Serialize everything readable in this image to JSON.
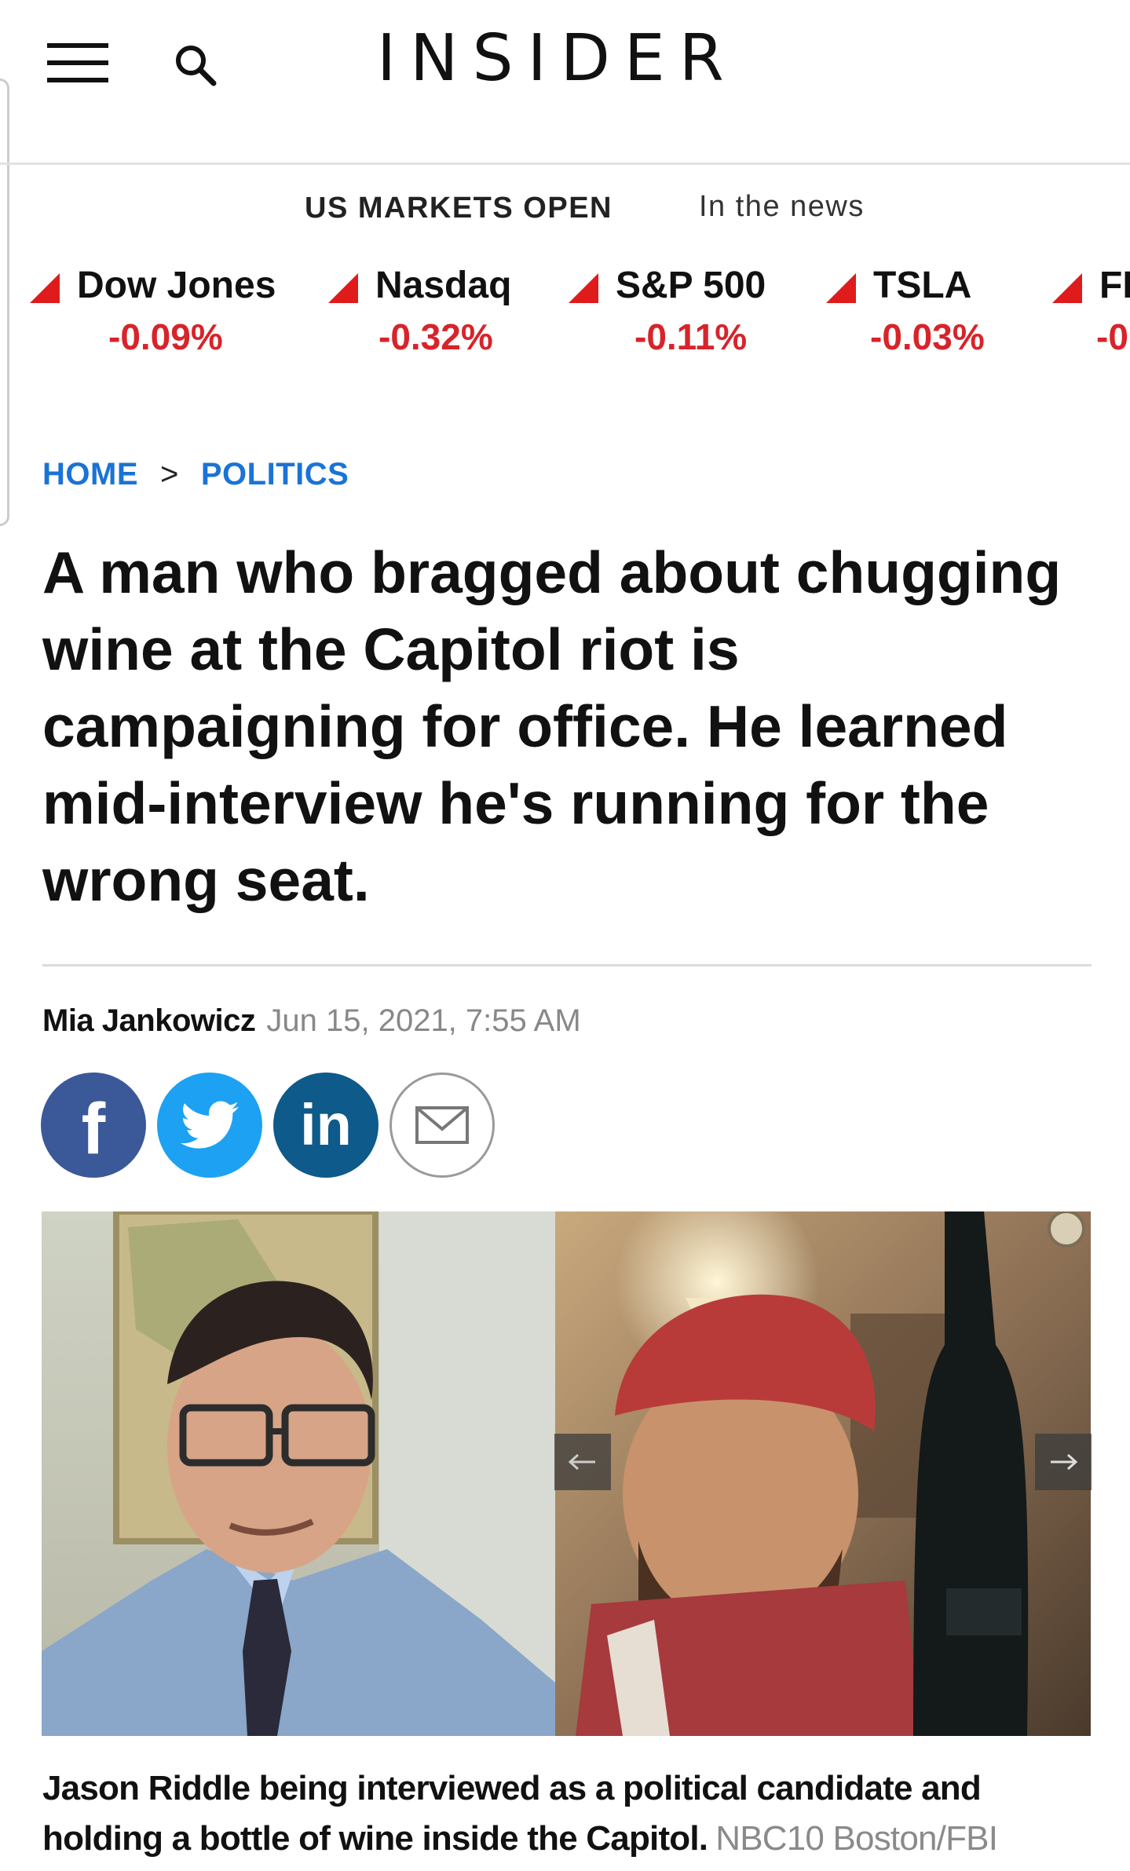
{
  "header": {
    "logo": "INSIDER",
    "menu_icon": "hamburger-menu-icon",
    "search_icon": "search-icon"
  },
  "markets": {
    "status": "US MARKETS OPEN",
    "in_the_news": "In the news",
    "tickers": [
      {
        "name": "Dow Jones",
        "change": "-0.09%",
        "direction": "down"
      },
      {
        "name": "Nasdaq",
        "change": "-0.32%",
        "direction": "down"
      },
      {
        "name": "S&P 500",
        "change": "-0.11%",
        "direction": "down"
      },
      {
        "name": "TSLA",
        "change": "-0.03%",
        "direction": "down"
      },
      {
        "name": "FI",
        "change": "-0",
        "direction": "down"
      }
    ]
  },
  "breadcrumb": {
    "home": "HOME",
    "separator": ">",
    "section": "POLITICS"
  },
  "article": {
    "headline": "A man who bragged about chugging wine at the Capitol riot is campaigning for office. He learned mid-interview he's running for the wrong seat.",
    "author": "Mia Jankowicz",
    "date": "Jun 15, 2021, 7:55 AM",
    "share": {
      "facebook": "f",
      "linkedin": "in"
    },
    "image": {
      "caption": "Jason Riddle being interviewed as a political candidate and holding a bottle of wine inside the Capitol.",
      "credit": "NBC10 Boston/FBI"
    }
  },
  "colors": {
    "negative": "#d8232a",
    "link": "#1a73d6",
    "facebook": "#3b5998",
    "twitter": "#1da1f2",
    "linkedin": "#0e5a8a"
  }
}
